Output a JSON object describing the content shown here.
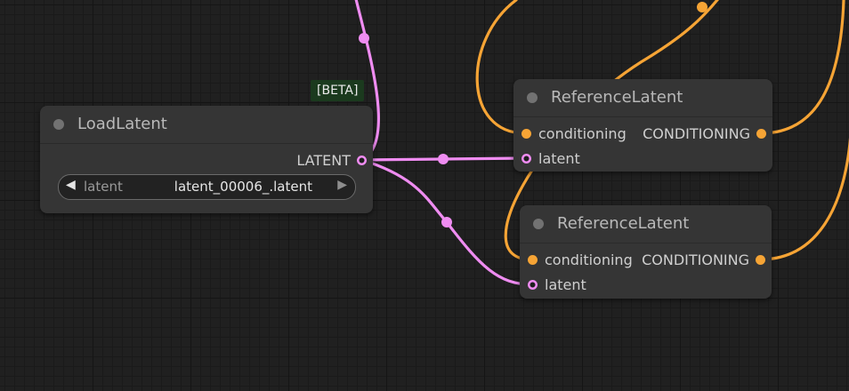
{
  "canvas": {
    "colors": {
      "background": "#202020",
      "node_bg": "#353535",
      "conditioning": "#f6a435",
      "latent": "#ef8cf1",
      "badge_bg": "#1b3a1e"
    }
  },
  "badge": {
    "text": "[BETA]"
  },
  "load_latent": {
    "title": "LoadLatent",
    "output_label": "LATENT",
    "widget": {
      "label": "latent",
      "value": "latent_00006_.latent",
      "prev_icon": "◀",
      "next_icon": "▶"
    }
  },
  "reference_latent_1": {
    "title": "ReferenceLatent",
    "inputs": [
      "conditioning",
      "latent"
    ],
    "output_label": "CONDITIONING"
  },
  "reference_latent_2": {
    "title": "ReferenceLatent",
    "inputs": [
      "conditioning",
      "latent"
    ],
    "output_label": "CONDITIONING"
  }
}
